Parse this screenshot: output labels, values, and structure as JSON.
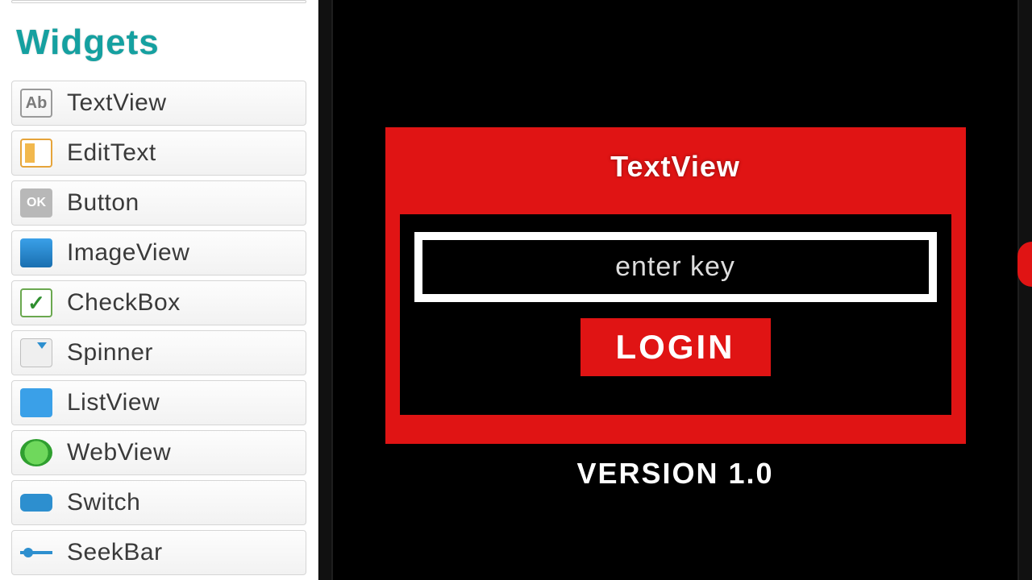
{
  "palette": {
    "heading": "Widgets",
    "items": [
      {
        "label": "TextView"
      },
      {
        "label": "EditText"
      },
      {
        "label": "Button"
      },
      {
        "label": "ImageView"
      },
      {
        "label": "CheckBox"
      },
      {
        "label": "Spinner"
      },
      {
        "label": "ListView"
      },
      {
        "label": "WebView"
      },
      {
        "label": "Switch"
      },
      {
        "label": "SeekBar"
      }
    ]
  },
  "preview": {
    "textview_label": "TextView",
    "key_placeholder": "enter key",
    "login_label": "LOGIN",
    "version_label": "VERSION 1.0"
  },
  "colors": {
    "accent_red": "#e01414",
    "heading_teal": "#15a0a0"
  }
}
